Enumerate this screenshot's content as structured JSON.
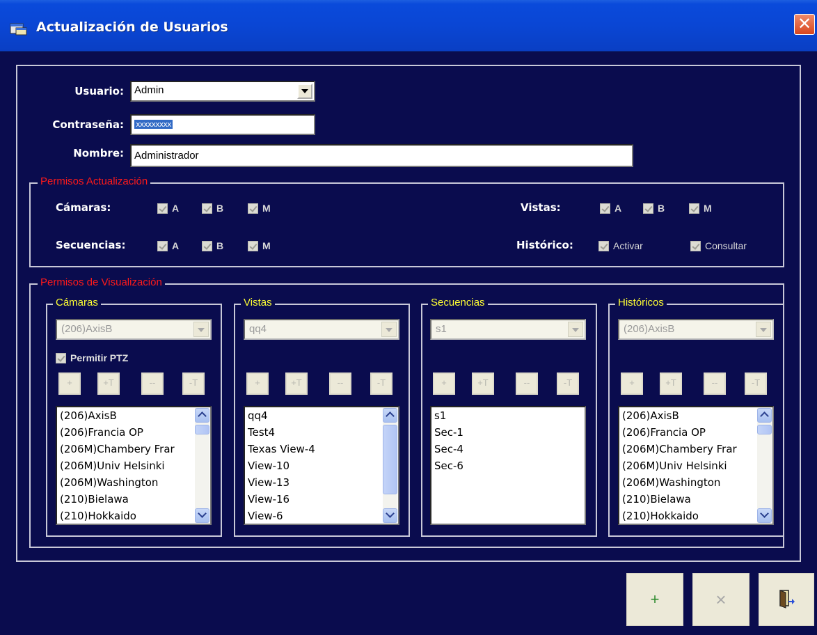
{
  "window": {
    "title": "Actualización de Usuarios",
    "close_icon": "close-icon",
    "app_icon": "window-app-icon"
  },
  "form": {
    "usuario_label": "Usuario:",
    "usuario_value": "Admin",
    "contrasena_label": "Contraseña:",
    "contrasena_value": "xxxxxxxxx",
    "nombre_label": "Nombre:",
    "nombre_value": "Administrador"
  },
  "permisos_actualizacion": {
    "legend": "Permisos Actualización",
    "camaras": {
      "label": "Cámaras:",
      "checks": [
        "A",
        "B",
        "M"
      ]
    },
    "secuencias": {
      "label": "Secuencias:",
      "checks": [
        "A",
        "B",
        "M"
      ]
    },
    "vistas": {
      "label": "Vistas:",
      "checks": [
        "A",
        "B",
        "M"
      ]
    },
    "historico": {
      "label": "Histórico:",
      "checks": [
        "Activar",
        "Consultar"
      ]
    }
  },
  "permisos_visualizacion": {
    "legend": "Permisos de Visualización",
    "panels": [
      {
        "legend": "Cámaras",
        "combo_value": "(206)AxisB",
        "ptz_label": "Permitir PTZ",
        "buttons": [
          "+",
          "+T",
          "--",
          "-T"
        ],
        "items": [
          "(206)AxisB",
          "(206)Francia OP",
          "(206M)Chambery Frar",
          "(206M)Univ Helsinki",
          "(206M)Washington",
          "(210)Bielawa",
          "(210)Hokkaido"
        ]
      },
      {
        "legend": "Vistas",
        "combo_value": "qq4",
        "buttons": [
          "+",
          "+T",
          "--",
          "-T"
        ],
        "items": [
          "qq4",
          "Test4",
          "Texas View-4",
          "View-10",
          "View-13",
          "View-16",
          "View-6"
        ]
      },
      {
        "legend": "Secuencias",
        "combo_value": "s1",
        "buttons": [
          "+",
          "+T",
          "--",
          "-T"
        ],
        "items": [
          "s1",
          "Sec-1",
          "Sec-4",
          "Sec-6"
        ]
      },
      {
        "legend": "Históricos",
        "combo_value": "(206)AxisB",
        "buttons": [
          "+",
          "+T",
          "--",
          "-T"
        ],
        "items": [
          "(206)AxisB",
          "(206)Francia OP",
          "(206M)Chambery Frar",
          "(206M)Univ Helsinki",
          "(206M)Washington",
          "(210)Bielawa",
          "(210)Hokkaido"
        ]
      }
    ]
  },
  "actions": {
    "add_label": "+",
    "delete_label": "×",
    "exit_icon": "exit-door-icon"
  },
  "colors": {
    "background": "#0a0c4e",
    "legend_primary": "#ff1a1a",
    "legend_secondary": "#ffff33",
    "titlebar": "#0a46d4",
    "selection": "#316ac5"
  }
}
